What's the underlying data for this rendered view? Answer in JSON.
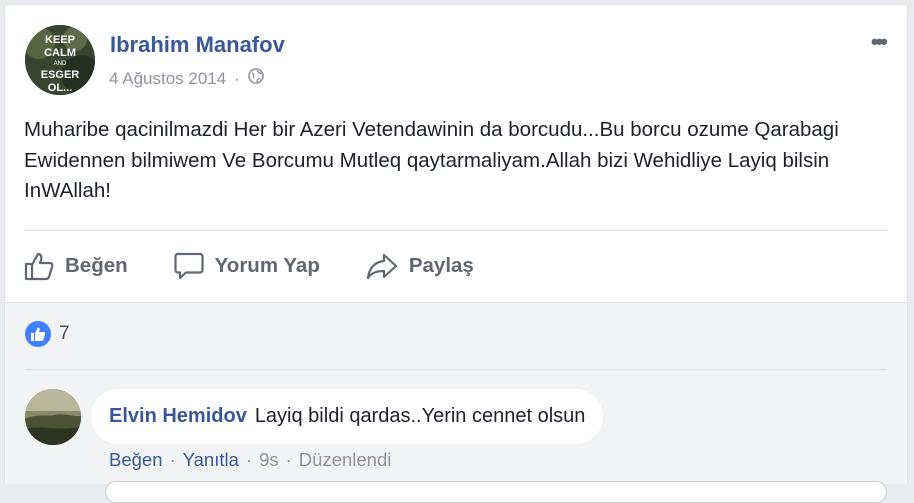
{
  "post": {
    "author": "Ibrahim Manafov",
    "date": "4 Ağustos 2014",
    "separator": "·",
    "privacy_icon": "globe-icon",
    "more_icon": "more-options-icon",
    "text": "Muharibe qacinilmazdi Her bir Azeri Vetendawinin da borcudu...Bu borcu ozume Qarabagi Ewidennen bilmiwem Ve Borcumu Mutleq qaytarmaliyam.Allah bizi Wehidliye Layiq bilsin InWAllah!",
    "avatar_text": [
      "KEEP",
      "CALM",
      "AND",
      "ESGER",
      "OL..."
    ]
  },
  "actions": {
    "like": "Beğen",
    "comment": "Yorum Yap",
    "share": "Paylaş"
  },
  "reactions": {
    "count": "7",
    "icon": "like-icon"
  },
  "comment": {
    "author": "Elvin Hemidov",
    "text": "Layiq bildi qardas..Yerin cennet olsun",
    "like": "Beğen",
    "reply": "Yanıtla",
    "time": "9s",
    "edited": "Düzenlendi",
    "separator": "·"
  },
  "colors": {
    "link": "#385898",
    "secondary_text": "#90949c",
    "like_blue": "#4080ff"
  }
}
